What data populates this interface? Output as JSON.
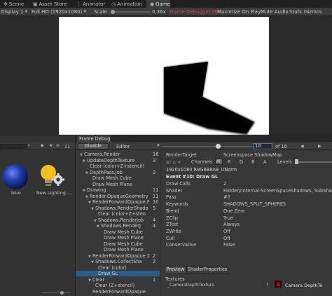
{
  "tabs": {
    "scene": "Scene",
    "asset_store": "Asset Store",
    "animator": "Animator",
    "animation": "Animation",
    "game": "Game"
  },
  "game_toolbar": {
    "display": "Display 1",
    "resolution": "Full HD (1920x1080)",
    "scale_label": "Scale",
    "scale_value": "0.36x",
    "frame_debugger_on": "Frame Debugger On",
    "maximize_on_play": "Maximize On Play",
    "mute_audio": "Mute Audio",
    "stats": "Stats",
    "gizmos": "Gizmos"
  },
  "project": {
    "toolbar_count": "11",
    "assets": [
      {
        "name": "blue",
        "icon": "material-sphere-icon"
      },
      {
        "name": "New Lighting ...",
        "icon": "lighting-settings-icon"
      }
    ]
  },
  "frame_debug": {
    "tab": "Frame Debug",
    "disable_btn": "Disable",
    "editor_dropdown": "Editor",
    "event_current": "10",
    "event_of": "of 16",
    "slider_fraction": 0.625
  },
  "tree": [
    {
      "label": "Camera.Render",
      "count": "16",
      "depth": 0,
      "open": true
    },
    {
      "label": "UpdateDepthTexture",
      "count": "3",
      "depth": 1,
      "open": true
    },
    {
      "label": "Clear (color+Z+stencil)",
      "count": "",
      "depth": 2,
      "open": false
    },
    {
      "label": "DepthPass.Job",
      "count": "2",
      "depth": 2,
      "open": true
    },
    {
      "label": "Draw Mesh Cube",
      "count": "",
      "depth": 3,
      "open": false
    },
    {
      "label": "Draw Mesh Plane",
      "count": "",
      "depth": 3,
      "open": false
    },
    {
      "label": "Drawing",
      "count": "11",
      "depth": 1,
      "open": true
    },
    {
      "label": "Render.OpaqueGeometry",
      "count": "11",
      "depth": 2,
      "open": true
    },
    {
      "label": "RenderForwardOpaque.F",
      "count": "10",
      "depth": 3,
      "open": true
    },
    {
      "label": "Shadows.RenderShado",
      "count": "5",
      "depth": 4,
      "open": true
    },
    {
      "label": "Clear (color+Z+sten",
      "count": "",
      "depth": 5,
      "open": false
    },
    {
      "label": "Shadows.RenderJob",
      "count": "4",
      "depth": 5,
      "open": true
    },
    {
      "label": "Shadows.RenderJ",
      "count": "4",
      "depth": 6,
      "open": true
    },
    {
      "label": "Draw Mesh Cube",
      "count": "",
      "depth": 7,
      "open": false
    },
    {
      "label": "Draw Mesh Plane",
      "count": "",
      "depth": 7,
      "open": false
    },
    {
      "label": "Draw Mesh Cube",
      "count": "",
      "depth": 7,
      "open": false
    },
    {
      "label": "Draw Mesh Plane",
      "count": "",
      "depth": 7,
      "open": false
    },
    {
      "label": "RenderForwardOpaque.2",
      "count": "2",
      "depth": 3,
      "open": true
    },
    {
      "label": "Shadows.CollectSha",
      "count": "2",
      "depth": 4,
      "open": true
    },
    {
      "label": "Clear (color)",
      "count": "",
      "depth": 5,
      "open": false
    },
    {
      "label": "Draw GL",
      "count": "",
      "depth": 5,
      "open": false,
      "selected": true
    },
    {
      "label": "Clear",
      "count": "1",
      "depth": 3,
      "open": true
    },
    {
      "label": "Clear (Z+stencil)",
      "count": "",
      "depth": 4,
      "open": false
    },
    {
      "label": "RenderForwardOpaque.",
      "count": "",
      "depth": 3,
      "open": false
    }
  ],
  "details": {
    "render_target_label": "RenderTarget",
    "render_target_value": "Screenspace ShadowMap",
    "rt0": "RT 0",
    "channels": "Channels",
    "ch_all": "All",
    "ch_r": "R",
    "ch_g": "G",
    "ch_b": "B",
    "ch_a": "A",
    "levels": "Levels",
    "format": "1920x1080 R8G8B8A8_UNorm",
    "event": "Event #10: Draw GL",
    "props": [
      {
        "k": "Draw Calls",
        "v": "2"
      },
      {
        "k": "Shader",
        "v": "Hidden/Internal-ScreenSpaceShadows, SubSha"
      },
      {
        "k": "Pass",
        "v": "#0"
      },
      {
        "k": "Keywords",
        "v": "SHADOWS_SPLIT_SPHERES"
      },
      {
        "k": "Blend",
        "v": "One Zero"
      },
      {
        "k": "ZClip",
        "v": "True"
      },
      {
        "k": "ZTest",
        "v": "Always"
      },
      {
        "k": "ZWrite",
        "v": "Off"
      },
      {
        "k": "Cull",
        "v": "Off"
      },
      {
        "k": "Conservative",
        "v": "False"
      }
    ],
    "preview_tab": "Preview",
    "shader_props_tab": "ShaderProperties",
    "textures_header": "Textures",
    "texture_name": "_CameraDepthTexture",
    "texture_flag": "f",
    "texture_value": "Camera DepthTe"
  },
  "colors": {
    "selected": "#2c5d87",
    "frame_debugger_red": "#e04848",
    "sphere_blue": "#1f3fb0",
    "bulb_yellow": "#f2c01e"
  }
}
